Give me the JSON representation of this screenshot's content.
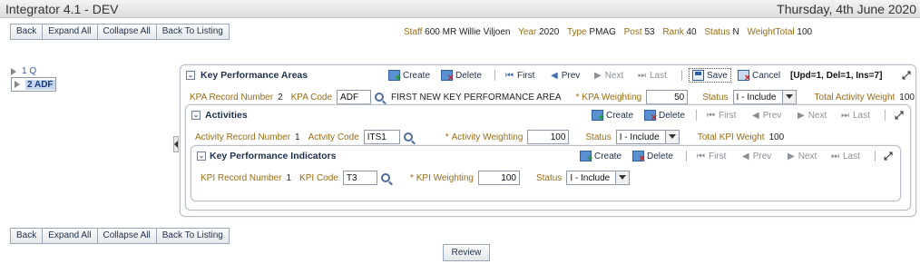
{
  "header": {
    "app_title": "Integrator 4.1 - DEV",
    "date": "Thursday, 4th June 2020"
  },
  "toolbar": {
    "back": "Back",
    "expand_all": "Expand All",
    "collapse_all": "Collapse All",
    "back_to_listing": "Back To Listing",
    "review": "Review"
  },
  "staff": {
    "staff_label": "Staff",
    "staff_value": "600 MR Willie Viljoen",
    "year_label": "Year",
    "year_value": "2020",
    "type_label": "Type",
    "type_value": "PMAG",
    "post_label": "Post",
    "post_value": "53",
    "rank_label": "Rank",
    "rank_value": "40",
    "status_label": "Status",
    "status_value": "N",
    "weight_label": "WeightTotal",
    "weight_value": "100"
  },
  "tree": [
    {
      "label": "1 Q"
    },
    {
      "label": "2 ADF"
    }
  ],
  "kpa": {
    "title": "Key Performance Areas",
    "create": "Create",
    "delete": "Delete",
    "first": "First",
    "prev": "Prev",
    "next": "Next",
    "last": "Last",
    "save": "Save",
    "cancel": "Cancel",
    "counts": "[Upd=1, Del=1, Ins=7]",
    "record_label": "KPA Record Number",
    "record_value": "2",
    "code_label": "KPA Code",
    "code_value": "ADF",
    "description": "FIRST NEW KEY PERFORMANCE AREA",
    "weighting_label": "KPA Weighting",
    "weighting_value": "50",
    "status_label": "Status",
    "status_value": "I - Include",
    "total_label": "Total Activity Weight",
    "total_value": "100"
  },
  "activities": {
    "title": "Activities",
    "create": "Create",
    "delete": "Delete",
    "first": "First",
    "prev": "Prev",
    "next": "Next",
    "last": "Last",
    "record_label": "Activity Record Number",
    "record_value": "1",
    "code_label": "Actvity Code",
    "code_value": "ITS1",
    "weighting_label": "Activity Weighting",
    "weighting_value": "100",
    "status_label": "Status",
    "status_value": "I - Include",
    "total_label": "Total KPI Weight",
    "total_value": "100"
  },
  "kpi": {
    "title": "Key Performance Indicators",
    "create": "Create",
    "delete": "Delete",
    "first": "First",
    "prev": "Prev",
    "next": "Next",
    "last": "Last",
    "record_label": "KPI Record Number",
    "record_value": "1",
    "code_label": "KPI Code",
    "code_value": "T3",
    "weighting_label": "KPI Weighting",
    "weighting_value": "100",
    "status_label": "Status",
    "status_value": "I - Include"
  }
}
